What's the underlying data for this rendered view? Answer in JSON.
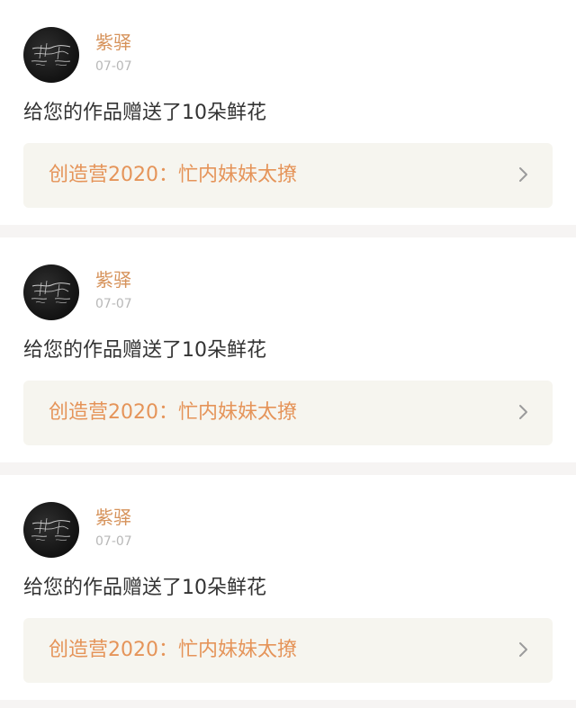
{
  "colors": {
    "background": "#f6f4f3",
    "card": "#ffffff",
    "username": "#d6925a",
    "date": "#b8b8b8",
    "message": "#333333",
    "work_bg": "#f6f5ef",
    "work_text": "#e59459",
    "chevron": "#9b9b9b"
  },
  "notifications": [
    {
      "user": "紫驿",
      "date": "07-07",
      "message": "给您的作品赠送了10朵鲜花",
      "work": "创造营2020：忙内妹妹太撩",
      "avatar_icon": "user-avatar-dark",
      "chevron_icon": "chevron-right-icon"
    },
    {
      "user": "紫驿",
      "date": "07-07",
      "message": "给您的作品赠送了10朵鲜花",
      "work": "创造营2020：忙内妹妹太撩",
      "avatar_icon": "user-avatar-dark",
      "chevron_icon": "chevron-right-icon"
    },
    {
      "user": "紫驿",
      "date": "07-07",
      "message": "给您的作品赠送了10朵鲜花",
      "work": "创造营2020：忙内妹妹太撩",
      "avatar_icon": "user-avatar-dark",
      "chevron_icon": "chevron-right-icon"
    }
  ]
}
